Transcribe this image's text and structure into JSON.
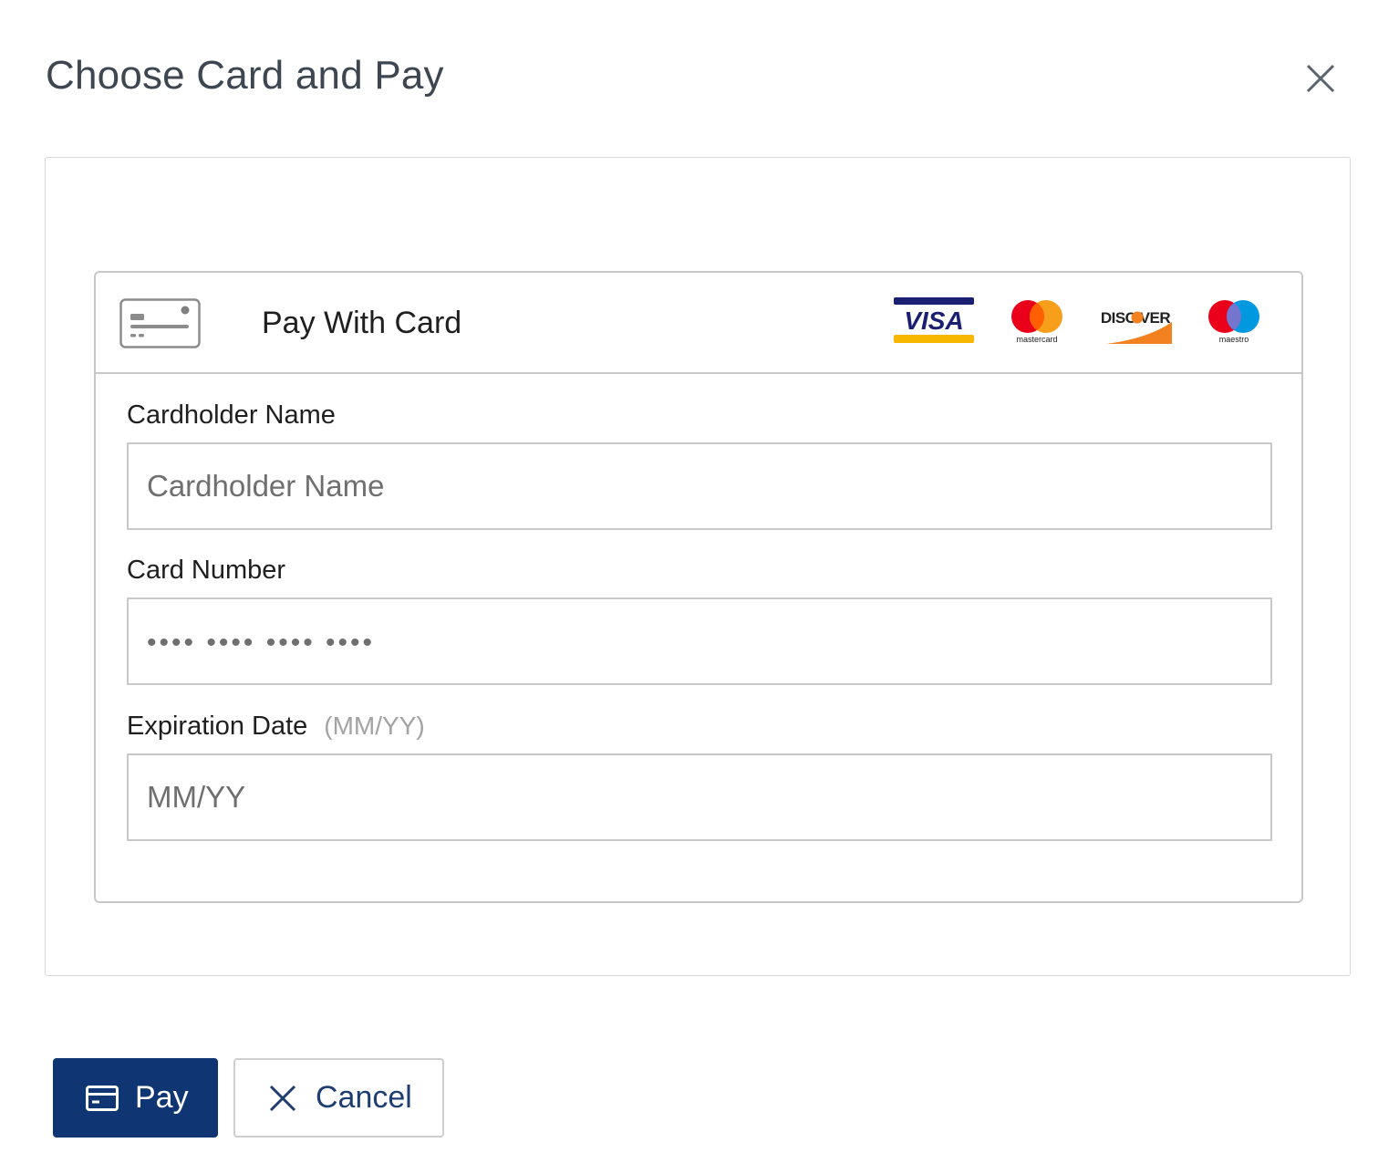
{
  "dialog": {
    "title": "Choose Card and Pay",
    "close_icon": "close-icon"
  },
  "card_panel": {
    "title": "Pay With Card",
    "icon": "credit-card-icon",
    "brands": [
      {
        "name": "VISA",
        "icon": "visa-logo"
      },
      {
        "name": "mastercard",
        "icon": "mastercard-logo"
      },
      {
        "name": "DISCOVER",
        "icon": "discover-logo"
      },
      {
        "name": "maestro",
        "icon": "maestro-logo"
      }
    ]
  },
  "fields": {
    "cardholder_name": {
      "label": "Cardholder Name",
      "placeholder": "Cardholder Name",
      "value": ""
    },
    "card_number": {
      "label": "Card Number",
      "placeholder": "•••• •••• •••• ••••",
      "value": ""
    },
    "expiration_date": {
      "label": "Expiration Date",
      "hint": "(MM/YY)",
      "placeholder": "MM/YY",
      "value": ""
    }
  },
  "actions": {
    "pay_label": "Pay",
    "pay_icon": "credit-card-icon",
    "cancel_label": "Cancel",
    "cancel_icon": "close-icon"
  },
  "colors": {
    "primary": "#0f3572",
    "title": "#3e4651",
    "border": "#c8c8c8",
    "visa_blue": "#1a1f71",
    "visa_gold": "#f7b600",
    "mastercard_red": "#eb001b",
    "mastercard_orange": "#f79e1b",
    "discover_orange": "#f48120",
    "maestro_blue": "#0099df"
  }
}
